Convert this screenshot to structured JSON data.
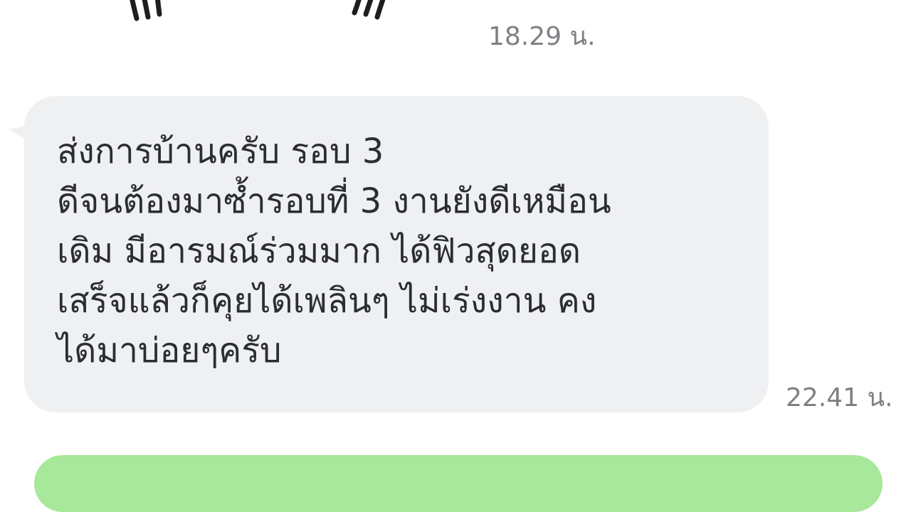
{
  "messages": [
    {
      "type": "sticker",
      "sticker_icon": "hand-drawn-sticker-icon",
      "time": "18.29 น."
    },
    {
      "type": "text",
      "direction": "incoming",
      "lines": [
        "ส่งการบ้านครับ รอบ 3",
        "ดีจนต้องมาซ้ำรอบที่ 3 งานยังดีเหมือน",
        "เดิม มีอารมณ์ร่วมมาก ได้ฟิวสุดยอด",
        "เสร็จแล้วก็คุยได้เพลินๆ ไม่เร่งงาน คง",
        "ได้มาบ่อยๆครับ"
      ],
      "time": "22.41 น."
    },
    {
      "type": "text",
      "direction": "outgoing",
      "lines": []
    }
  ],
  "colors": {
    "background": "#ffffff",
    "incoming_bubble": "#eff0f2",
    "outgoing_bubble": "#a8e89a",
    "message_text": "#2b2d30",
    "timestamp": "#7d8186"
  }
}
